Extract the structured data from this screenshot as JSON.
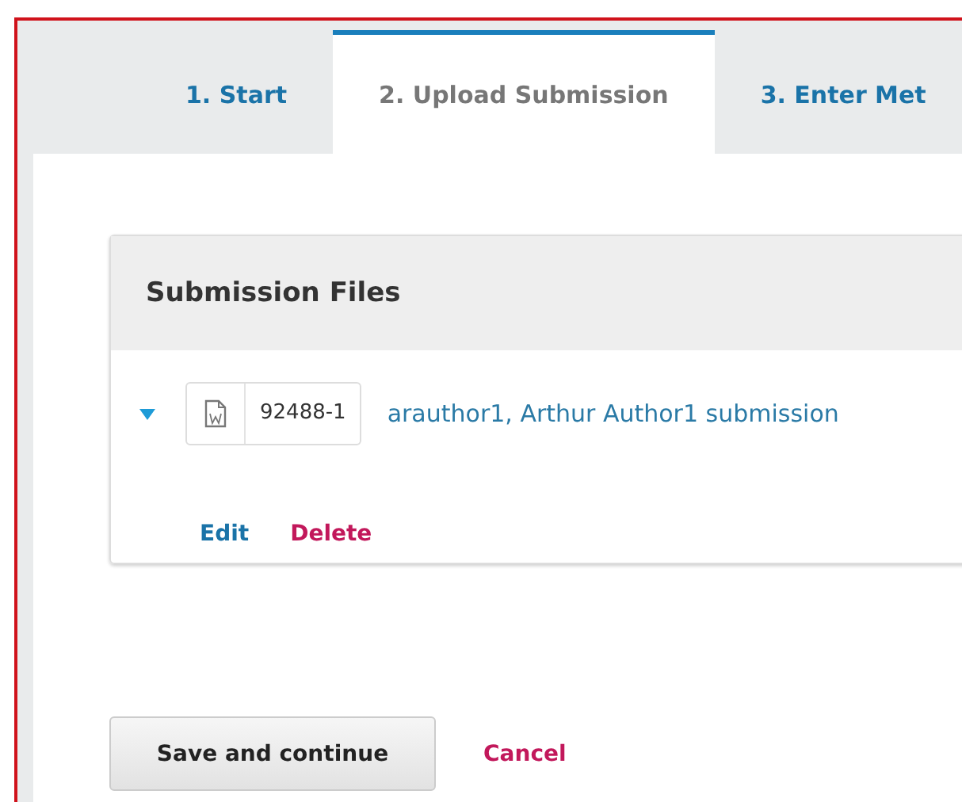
{
  "tabs": [
    {
      "label": "1. Start",
      "selected": false
    },
    {
      "label": "2. Upload Submission",
      "selected": true
    },
    {
      "label": "3. Enter Met",
      "selected": false
    }
  ],
  "files_panel": {
    "title": "Submission Files",
    "files": [
      {
        "expanded": true,
        "id": "92488-1",
        "name": "arauthor1, Arthur Author1 submission",
        "actions": [
          {
            "label": "Edit",
            "kind": "edit"
          },
          {
            "label": "Delete",
            "kind": "delete"
          }
        ]
      }
    ]
  },
  "buttons": [
    {
      "label": "Save and continue",
      "kind": "primary"
    },
    {
      "label": "Cancel",
      "kind": "cancel"
    }
  ]
}
